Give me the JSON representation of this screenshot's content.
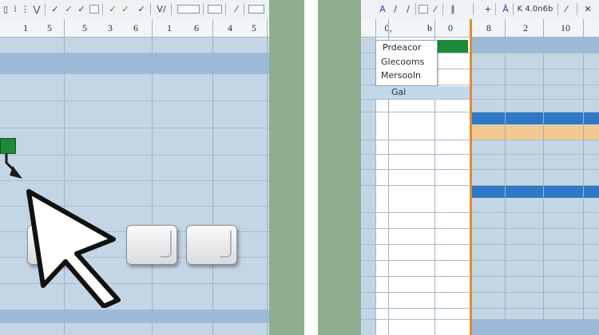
{
  "left_sheet": {
    "toolbar_glyphs": [
      "▯",
      "⁞",
      "⋮",
      "⋁",
      "✓",
      "✓",
      "✓",
      "✓",
      "✓",
      "V/",
      "⁄"
    ],
    "column_headers": [
      "1",
      "5",
      "5",
      "3",
      "6",
      "1",
      "6",
      "4",
      "5"
    ]
  },
  "right_sheet": {
    "toolbar_glyphs": [
      "A",
      "/",
      "/",
      "B",
      "⁄",
      "∥",
      "+",
      "Ā",
      "K 4.0n6b",
      "⁄",
      "✕"
    ],
    "column_headers": [
      "0,",
      "b",
      "0",
      "8",
      "2",
      "10"
    ],
    "dropdown_items": [
      "Prdeacor",
      "Glecooms",
      "Mersooln"
    ],
    "cell_label": "Gal"
  },
  "colors": {
    "row_band": "#9dbbd9",
    "accent_green": "#1e8a3a",
    "highlight_blue": "#2f78c8",
    "highlight_orange": "#f2c98e",
    "orange_line": "#e38b2c"
  }
}
